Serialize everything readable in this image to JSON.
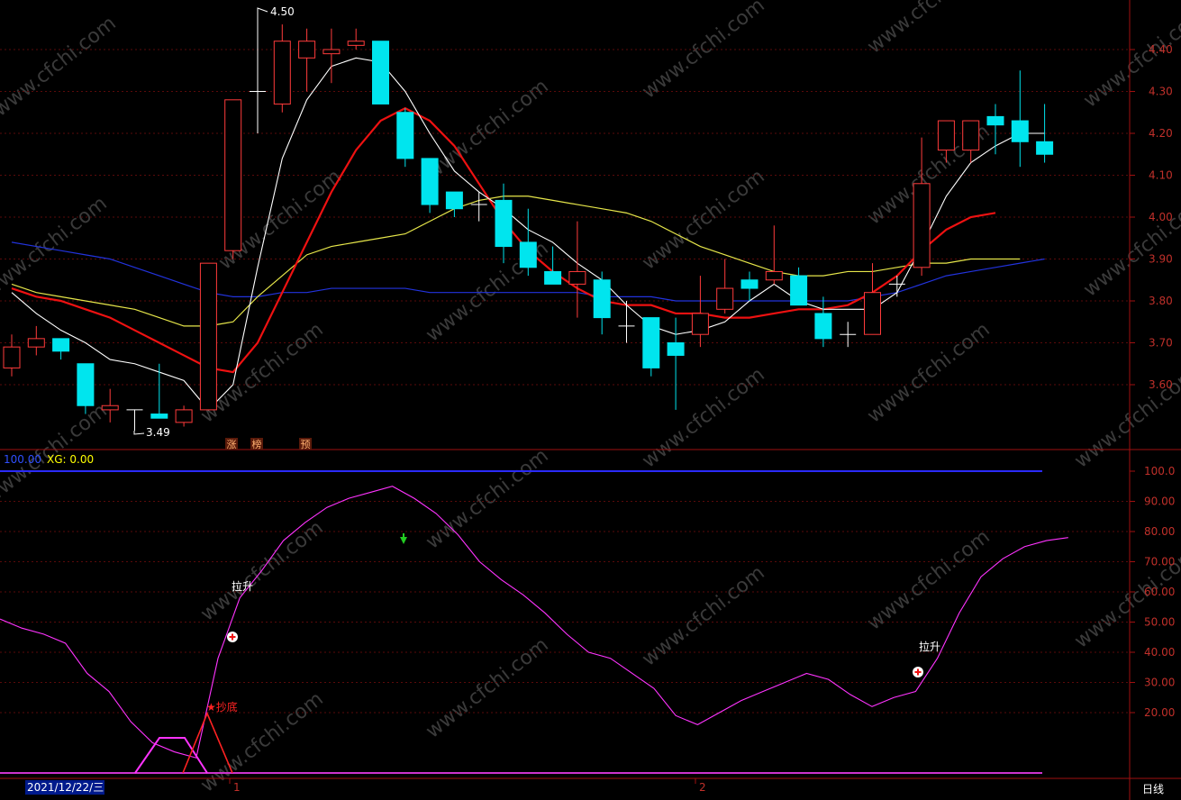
{
  "chart_data": [
    {
      "type": "candlestick",
      "y_ticks": [
        "4.40",
        "4.30",
        "4.20",
        "4.10",
        "4.00",
        "3.90",
        "3.80",
        "3.70",
        "3.60"
      ],
      "y_range": [
        3.47,
        4.52
      ],
      "high_marker": "4.50",
      "low_marker": "3.49",
      "signal_tags": [
        "涨",
        "榜",
        "预"
      ],
      "candles": [
        {
          "o": 3.64,
          "h": 3.72,
          "l": 3.62,
          "c": 3.69
        },
        {
          "o": 3.69,
          "h": 3.74,
          "l": 3.67,
          "c": 3.71
        },
        {
          "o": 3.71,
          "h": 3.71,
          "l": 3.66,
          "c": 3.68
        },
        {
          "o": 3.65,
          "h": 3.65,
          "l": 3.53,
          "c": 3.55
        },
        {
          "o": 3.54,
          "h": 3.59,
          "l": 3.51,
          "c": 3.55
        },
        {
          "o": 3.54,
          "h": 3.54,
          "l": 3.49,
          "c": 3.54
        },
        {
          "o": 3.53,
          "h": 3.65,
          "l": 3.52,
          "c": 3.52
        },
        {
          "o": 3.51,
          "h": 3.55,
          "l": 3.5,
          "c": 3.54
        },
        {
          "o": 3.54,
          "h": 3.89,
          "l": 3.54,
          "c": 3.89
        },
        {
          "o": 3.92,
          "h": 4.28,
          "l": 3.9,
          "c": 4.28
        },
        {
          "o": 4.3,
          "h": 4.49,
          "l": 4.2,
          "c": 4.3
        },
        {
          "o": 4.27,
          "h": 4.46,
          "l": 4.25,
          "c": 4.42
        },
        {
          "o": 4.38,
          "h": 4.45,
          "l": 4.3,
          "c": 4.42
        },
        {
          "o": 4.39,
          "h": 4.45,
          "l": 4.32,
          "c": 4.4
        },
        {
          "o": 4.41,
          "h": 4.45,
          "l": 4.4,
          "c": 4.42
        },
        {
          "o": 4.42,
          "h": 4.42,
          "l": 4.27,
          "c": 4.27
        },
        {
          "o": 4.25,
          "h": 4.26,
          "l": 4.12,
          "c": 4.14
        },
        {
          "o": 4.14,
          "h": 4.14,
          "l": 4.01,
          "c": 4.03
        },
        {
          "o": 4.06,
          "h": 4.06,
          "l": 4.0,
          "c": 4.02
        },
        {
          "o": 4.03,
          "h": 4.06,
          "l": 3.99,
          "c": 4.03
        },
        {
          "o": 4.04,
          "h": 4.08,
          "l": 3.89,
          "c": 3.93
        },
        {
          "o": 3.94,
          "h": 4.02,
          "l": 3.86,
          "c": 3.88
        },
        {
          "o": 3.87,
          "h": 3.93,
          "l": 3.84,
          "c": 3.84
        },
        {
          "o": 3.84,
          "h": 3.99,
          "l": 3.76,
          "c": 3.87
        },
        {
          "o": 3.85,
          "h": 3.87,
          "l": 3.72,
          "c": 3.76
        },
        {
          "o": 3.74,
          "h": 3.8,
          "l": 3.7,
          "c": 3.74
        },
        {
          "o": 3.76,
          "h": 3.76,
          "l": 3.62,
          "c": 3.64
        },
        {
          "o": 3.7,
          "h": 3.76,
          "l": 3.54,
          "c": 3.67
        },
        {
          "o": 3.72,
          "h": 3.86,
          "l": 3.69,
          "c": 3.77
        },
        {
          "o": 3.78,
          "h": 3.9,
          "l": 3.77,
          "c": 3.83
        },
        {
          "o": 3.85,
          "h": 3.87,
          "l": 3.8,
          "c": 3.83
        },
        {
          "o": 3.85,
          "h": 3.98,
          "l": 3.84,
          "c": 3.87
        },
        {
          "o": 3.86,
          "h": 3.88,
          "l": 3.79,
          "c": 3.79
        },
        {
          "o": 3.77,
          "h": 3.81,
          "l": 3.69,
          "c": 3.71
        },
        {
          "o": 3.72,
          "h": 3.75,
          "l": 3.69,
          "c": 3.72
        },
        {
          "o": 3.72,
          "h": 3.89,
          "l": 3.72,
          "c": 3.82
        },
        {
          "o": 3.84,
          "h": 3.86,
          "l": 3.81,
          "c": 3.84
        },
        {
          "o": 3.88,
          "h": 4.19,
          "l": 3.86,
          "c": 4.08
        },
        {
          "o": 4.16,
          "h": 4.23,
          "l": 4.13,
          "c": 4.23
        },
        {
          "o": 4.16,
          "h": 4.23,
          "l": 4.13,
          "c": 4.23
        },
        {
          "o": 4.24,
          "h": 4.27,
          "l": 4.15,
          "c": 4.22
        },
        {
          "o": 4.23,
          "h": 4.35,
          "l": 4.12,
          "c": 4.18
        },
        {
          "o": 4.18,
          "h": 4.27,
          "l": 4.13,
          "c": 4.15
        }
      ],
      "ma_white": [
        3.82,
        3.77,
        3.73,
        3.7,
        3.66,
        3.65,
        3.63,
        3.61,
        3.54,
        3.6,
        3.88,
        4.14,
        4.28,
        4.36,
        4.38,
        4.37,
        4.3,
        4.2,
        4.11,
        4.06,
        4.02,
        3.97,
        3.94,
        3.89,
        3.85,
        3.79,
        3.74,
        3.72,
        3.73,
        3.75,
        3.8,
        3.84,
        3.8,
        3.78,
        3.78,
        3.78,
        3.82,
        3.93,
        4.05,
        4.13,
        4.17,
        4.2,
        4.2
      ],
      "ma_red": [
        3.83,
        3.81,
        3.8,
        3.78,
        3.76,
        3.73,
        3.7,
        3.67,
        3.64,
        3.63,
        3.7,
        3.82,
        3.94,
        4.06,
        4.16,
        4.23,
        4.26,
        4.23,
        4.17,
        4.08,
        3.99,
        3.92,
        3.87,
        3.83,
        3.8,
        3.79,
        3.79,
        3.77,
        3.77,
        3.76,
        3.76,
        3.77,
        3.78,
        3.78,
        3.79,
        3.82,
        3.86,
        3.92,
        3.97,
        4.0,
        4.01
      ],
      "ma_yellow": [
        3.84,
        3.82,
        3.81,
        3.8,
        3.79,
        3.78,
        3.76,
        3.74,
        3.74,
        3.75,
        3.81,
        3.86,
        3.91,
        3.93,
        3.94,
        3.95,
        3.96,
        3.99,
        4.02,
        4.04,
        4.05,
        4.05,
        4.04,
        4.03,
        4.02,
        4.01,
        3.99,
        3.96,
        3.93,
        3.91,
        3.89,
        3.87,
        3.86,
        3.86,
        3.87,
        3.87,
        3.88,
        3.89,
        3.89,
        3.9,
        3.9,
        3.9
      ],
      "ma_blue": [
        3.94,
        3.93,
        3.92,
        3.91,
        3.9,
        3.88,
        3.86,
        3.84,
        3.82,
        3.81,
        3.81,
        3.82,
        3.82,
        3.83,
        3.83,
        3.83,
        3.83,
        3.82,
        3.82,
        3.82,
        3.82,
        3.82,
        3.82,
        3.82,
        3.81,
        3.81,
        3.81,
        3.8,
        3.8,
        3.8,
        3.8,
        3.8,
        3.8,
        3.8,
        3.8,
        3.81,
        3.82,
        3.84,
        3.86,
        3.87,
        3.88,
        3.89,
        3.9
      ]
    },
    {
      "type": "line",
      "indicator_label": "100.00",
      "xg_label": "XG: 0.00",
      "y_ticks": [
        "100.0",
        "90.00",
        "80.00",
        "70.00",
        "60.00",
        "50.00",
        "40.00",
        "30.00",
        "20.00"
      ],
      "y_range": [
        0,
        104
      ],
      "reference_line": 100,
      "series": [
        {
          "color": "#ff33ff",
          "values": [
            51,
            48,
            46,
            43,
            33,
            27,
            17,
            10,
            7,
            5,
            38,
            58,
            67,
            77,
            83,
            88,
            91,
            93,
            95,
            91,
            86,
            79,
            70,
            64,
            59,
            53,
            46,
            40,
            38,
            33,
            28,
            19,
            16,
            20,
            24,
            27,
            30,
            33,
            31,
            26,
            22,
            25,
            27,
            38,
            53,
            65,
            71,
            75,
            77,
            78
          ]
        },
        {
          "color": "#ff33ff",
          "values": [
            0,
            0,
            0,
            0,
            0,
            0,
            11,
            11,
            11,
            11,
            0
          ]
        },
        {
          "color": "#ff2222",
          "values": [
            0,
            0,
            0,
            0,
            0,
            0,
            0,
            0,
            0,
            0,
            20,
            0
          ]
        }
      ],
      "annotations": [
        "拉升",
        "★抄底",
        "拉升"
      ]
    }
  ],
  "watermark": "www.cfchi.com",
  "date_label": "2021/12/22/三",
  "x_ticks": [
    "1",
    "2"
  ],
  "period": "日线"
}
